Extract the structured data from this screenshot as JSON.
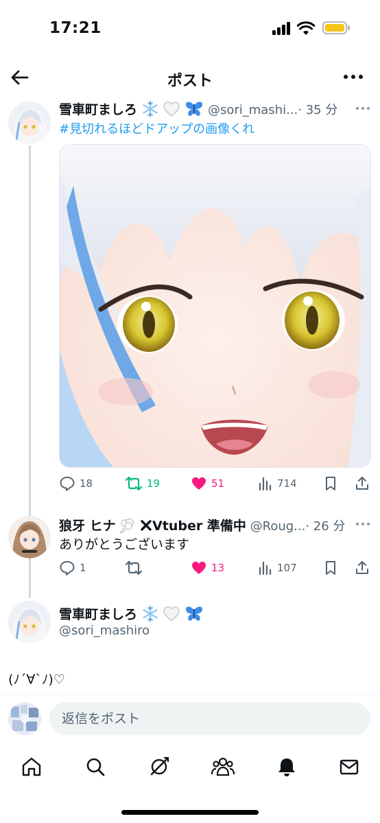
{
  "status_bar": {
    "time": "17:21"
  },
  "header": {
    "title": "ポスト"
  },
  "posts": [
    {
      "display_name": "雪車町ましろ",
      "handle": "@sori_mashi...",
      "time": "· 35 分",
      "hashtag": "#見切れるほどドアップの画像くれ",
      "actions": {
        "replies": "18",
        "reposts": "19",
        "likes": "51",
        "views": "714"
      }
    },
    {
      "display_name": "狼牙 ヒナ",
      "name_suffix": "Vtuber 準備中",
      "handle": "@Roug...",
      "time": "· 26 分",
      "text": "ありがとうございます",
      "actions": {
        "replies": "1",
        "reposts": "",
        "likes": "13",
        "views": "107"
      }
    },
    {
      "display_name": "雪車町ましろ",
      "handle": "@sori_mashiro",
      "text": "(ﾉ´∀`ﾉ)♡"
    }
  ],
  "reply": {
    "placeholder": "返信をポスト"
  },
  "colors": {
    "accent": "#1d9bf0",
    "repost": "#00ba7c",
    "like": "#f91880",
    "muted": "#536471"
  },
  "icons": {
    "tab_bar": [
      "home-icon",
      "search-icon",
      "grok-icon",
      "communities-icon",
      "bell-icon",
      "mail-icon"
    ],
    "post_actions": [
      "reply-icon",
      "repost-icon",
      "like-icon",
      "views-icon",
      "bookmark-icon",
      "share-icon"
    ]
  }
}
